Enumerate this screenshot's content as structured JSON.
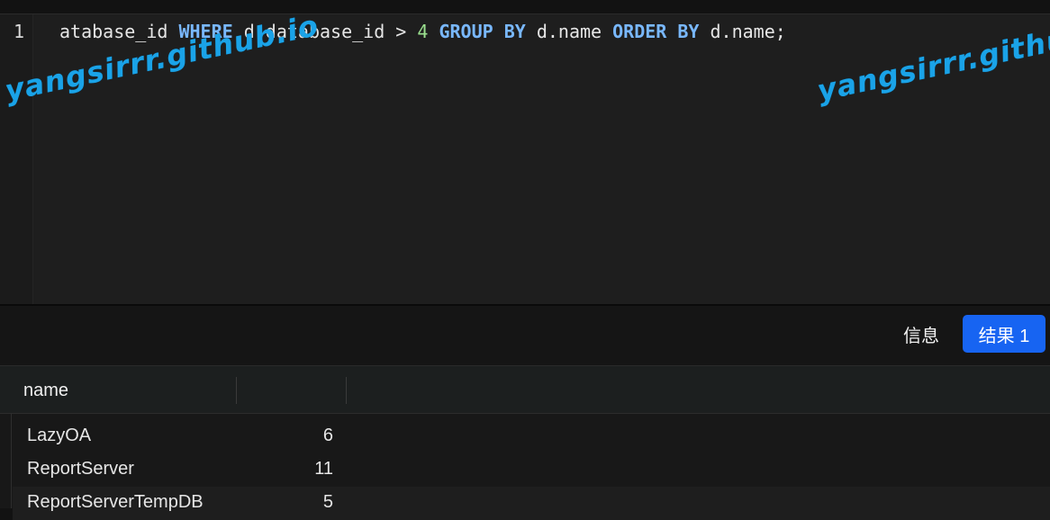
{
  "editor": {
    "line_number": "1",
    "tokens": [
      {
        "text": "atabase_id ",
        "cls": "plain"
      },
      {
        "text": "WHERE",
        "cls": "kw"
      },
      {
        "text": " d.database_id > ",
        "cls": "plain"
      },
      {
        "text": "4",
        "cls": "num"
      },
      {
        "text": " ",
        "cls": "plain"
      },
      {
        "text": "GROUP BY",
        "cls": "kw"
      },
      {
        "text": " d.name ",
        "cls": "plain"
      },
      {
        "text": "ORDER BY",
        "cls": "kw"
      },
      {
        "text": " d.name;",
        "cls": "plain"
      }
    ]
  },
  "watermark": {
    "text_left": "yangsirrr.github.io",
    "text_right": "yangsirrr.github.io"
  },
  "tabs": {
    "info_label": "信息",
    "result_label": "结果 1"
  },
  "grid": {
    "columns": [
      "name",
      ""
    ],
    "rows": [
      {
        "name": "LazyOA",
        "count": "6"
      },
      {
        "name": "ReportServer",
        "count": "11"
      },
      {
        "name": "ReportServerTempDB",
        "count": "5"
      }
    ]
  },
  "colors": {
    "accent": "#1764f2",
    "keyword": "#79b8ff",
    "number": "#9be08f",
    "watermark": "#1aa3e8"
  }
}
